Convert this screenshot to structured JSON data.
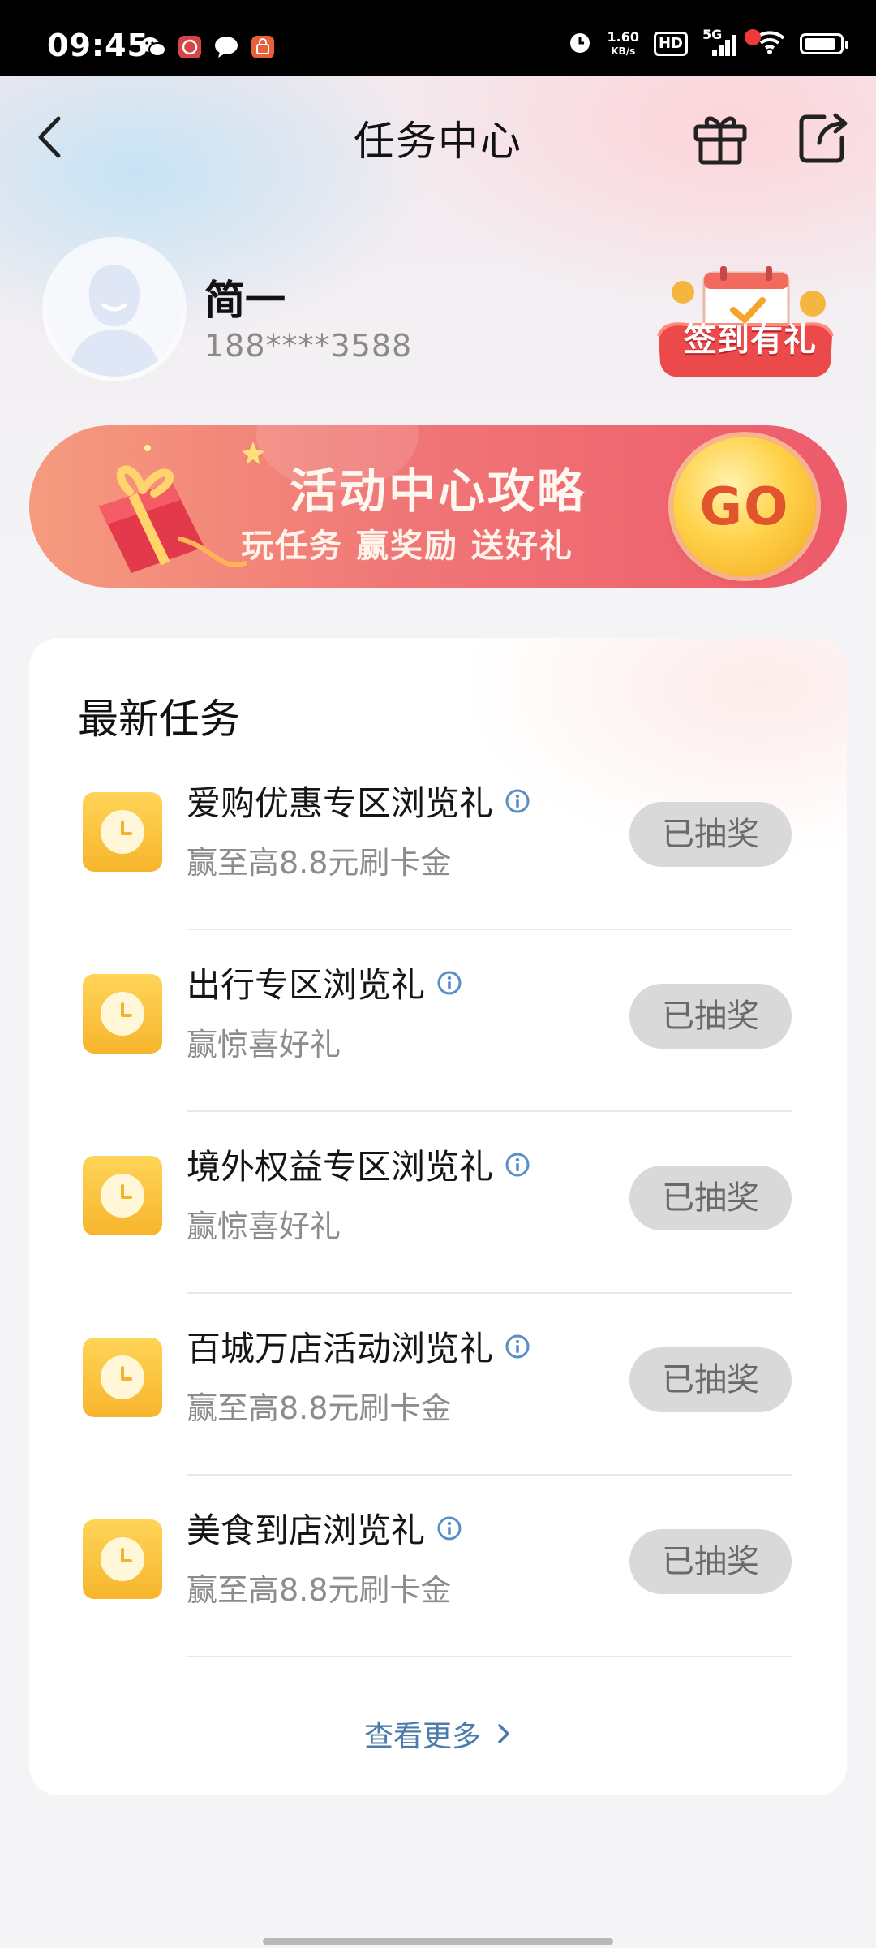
{
  "status_bar": {
    "time": "09:45",
    "network_speed_value": "1.60",
    "network_speed_unit": "KB/s",
    "hd_label": "HD",
    "network_type": "5G",
    "notif_icons": [
      "wechat-icon",
      "app-notification-icon",
      "message-icon",
      "shopping-app-icon"
    ],
    "right_icons": [
      "alarm-icon",
      "signal-icon",
      "wifi-icon",
      "battery-icon"
    ]
  },
  "header": {
    "title": "任务中心"
  },
  "profile": {
    "name": "简一",
    "phone": "188****3588",
    "checkin_label": "签到有礼"
  },
  "banner": {
    "title": "活动中心攻略",
    "subtitle": "玩任务 赢奖励 送好礼",
    "go_label": "GO"
  },
  "tasks": {
    "section_title": "最新任务",
    "items": [
      {
        "title": "爱购优惠专区浏览礼",
        "desc": "赢至高8.8元刷卡金",
        "button": "已抽奖"
      },
      {
        "title": "出行专区浏览礼",
        "desc": "赢惊喜好礼",
        "button": "已抽奖"
      },
      {
        "title": "境外权益专区浏览礼",
        "desc": "赢惊喜好礼",
        "button": "已抽奖"
      },
      {
        "title": "百城万店活动浏览礼",
        "desc": "赢至高8.8元刷卡金",
        "button": "已抽奖"
      },
      {
        "title": "美食到店浏览礼",
        "desc": "赢至高8.8元刷卡金",
        "button": "已抽奖"
      }
    ],
    "more_label": "查看更多"
  },
  "colors": {
    "accent_blue": "#4a7bab",
    "task_icon_yellow": "#f7b52c",
    "banner_red": "#ee5b6b",
    "badge_red": "#f03a3a",
    "disabled_button": "#d9d9d9"
  }
}
